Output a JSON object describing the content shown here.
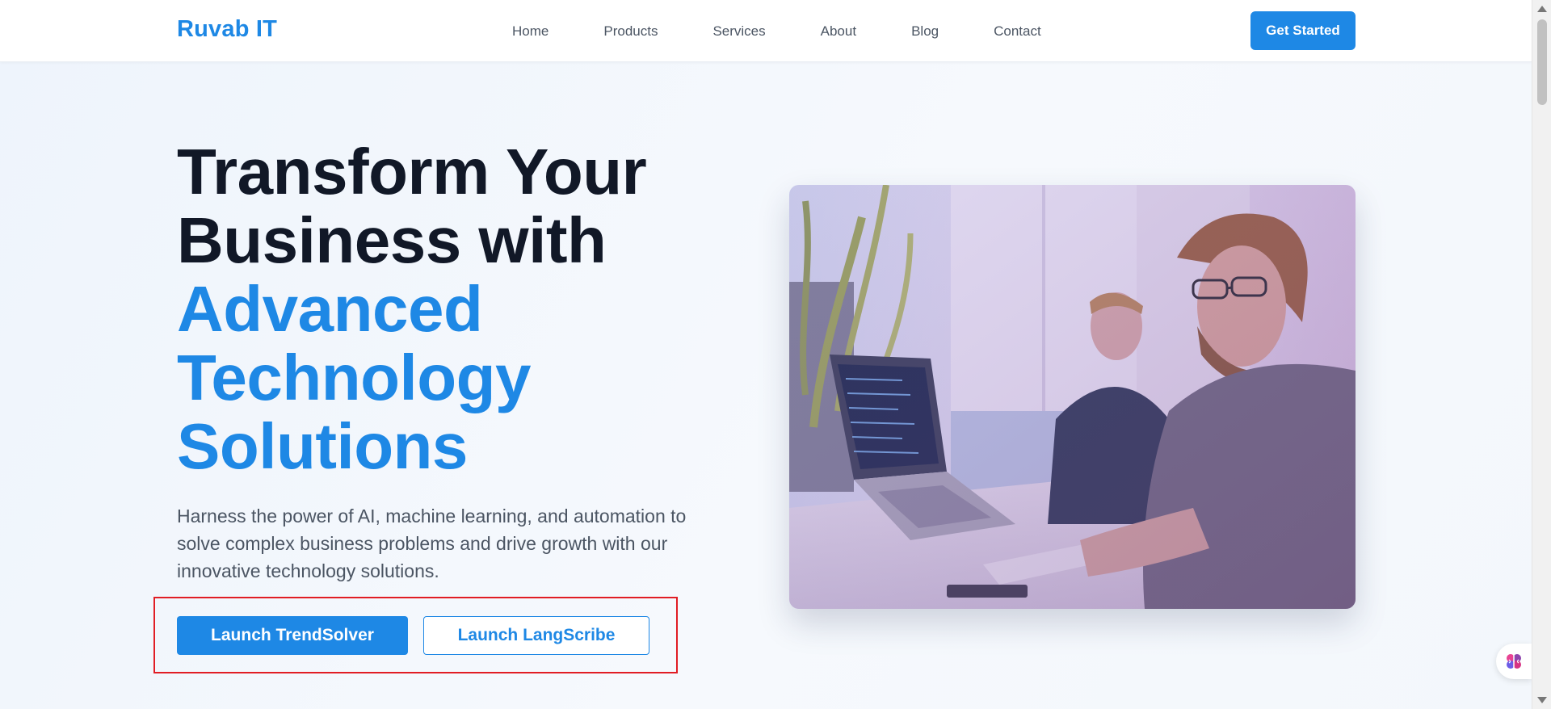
{
  "header": {
    "brand": "Ruvab IT",
    "nav": [
      {
        "label": "Home"
      },
      {
        "label": "Products"
      },
      {
        "label": "Services"
      },
      {
        "label": "About"
      },
      {
        "label": "Blog"
      },
      {
        "label": "Contact"
      }
    ],
    "cta_label": "Get Started"
  },
  "hero": {
    "title_line1": "Transform Your",
    "title_line2": "Business with",
    "title_accent1": "Advanced",
    "title_accent2": "Technology",
    "title_accent3": "Solutions",
    "subtitle": "Harness the power of AI, machine learning, and automation to solve complex business problems and drive growth with our innovative technology solutions.",
    "primary_button": "Launch TrendSolver",
    "secondary_button": "Launch LangScribe",
    "image_icon": "office-photo"
  },
  "colors": {
    "brand": "#1e88e5",
    "heading": "#111827",
    "body_text": "#4b5563",
    "highlight": "#e11d24"
  },
  "widget": {
    "icon": "brain-icon"
  }
}
